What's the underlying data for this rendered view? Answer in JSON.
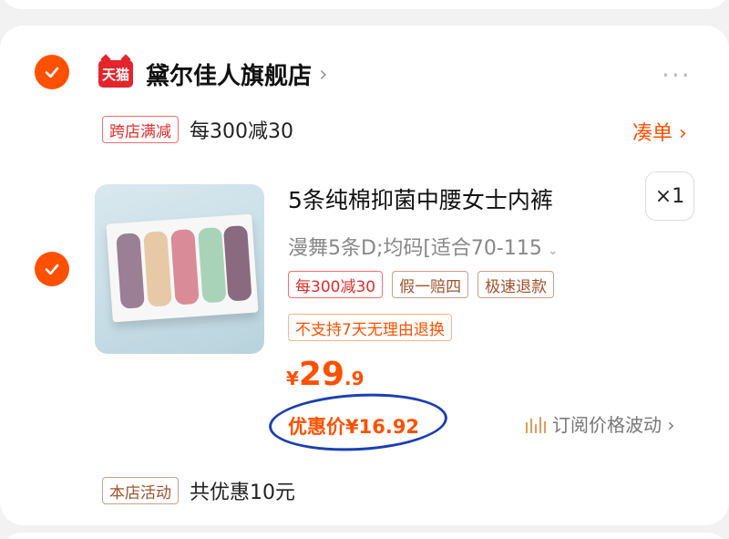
{
  "store": {
    "logo_text": "天猫",
    "name": "黛尔佳人旗舰店",
    "chevron": "›",
    "more": "···"
  },
  "promo": {
    "tag": "跨店满减",
    "text": "每300减30",
    "coudan": "凑单 ›"
  },
  "product": {
    "title": "5条纯棉抑菌中腰女士内裤",
    "quantity": "×1",
    "sku": "漫舞5条D;均码[适合70-115",
    "sku_chevron": "⌄",
    "tags": [
      "每300减30",
      "假一赔四",
      "极速退款"
    ],
    "return_policy": "不支持7天无理由退换",
    "price": {
      "symbol": "¥",
      "integer": "29",
      "decimal": ".9"
    },
    "discount_price": "优惠价¥16.92",
    "subscribe": "订阅价格波动 ›"
  },
  "activity": {
    "tag": "本店活动",
    "text": "共优惠10元"
  },
  "colors": {
    "accent": "#ff5000",
    "tmall_red": "#e4252c",
    "annotation_blue": "#1b3fb0"
  }
}
